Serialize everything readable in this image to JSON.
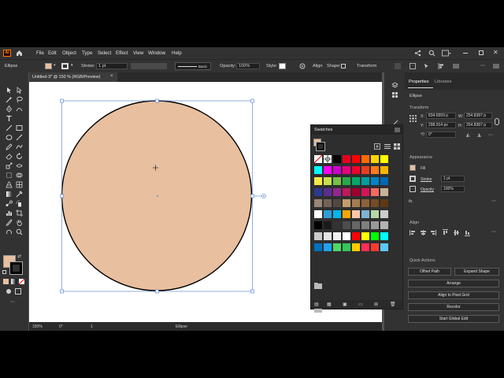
{
  "app": {
    "logo": "Ai"
  },
  "menu": [
    "File",
    "Edit",
    "Object",
    "Type",
    "Select",
    "Effect",
    "View",
    "Window",
    "Help"
  ],
  "control_bar": {
    "selection_type": "Ellipse",
    "stroke_label": "Stroke:",
    "stroke_value": "1 pt",
    "brush_label": "Basic",
    "opacity_label": "Opacity:",
    "opacity_value": "100%",
    "style_label": "Style:",
    "align_label": "Align",
    "shape_label": "Shape:",
    "transform_label": "Transform"
  },
  "document": {
    "tab_title": "Untitled-3* @ 150 % (RGB/Preview)",
    "close": "×"
  },
  "status": {
    "zoom": "150%",
    "rotation": "0°",
    "page": "1",
    "tool": "Ellipse"
  },
  "colors": {
    "fill": "#e8bf9f",
    "stroke": "#000000",
    "canvas": "#ffffff",
    "selection": "#4a7bd0"
  },
  "properties": {
    "tabs": [
      "Properties",
      "Libraries"
    ],
    "object_type": "Ellipse",
    "transform_title": "Transform",
    "x_label": "X:",
    "x_value": "834.6559 p",
    "y_label": "Y:",
    "y_value": "298.914 px",
    "w_label": "W:",
    "w_value": "254.8387 p",
    "h_label": "H:",
    "h_value": "254.8387 p",
    "angle_value": "0°",
    "appearance_title": "Appearance",
    "fill_label": "Fill",
    "stroke_label": "Stroke",
    "stroke_value": "1 pt",
    "opacity_label": "Opacity",
    "opacity_value": "100%",
    "fx_label": "fx.",
    "align_title": "Align",
    "quick_actions_title": "Quick Actions",
    "buttons": [
      "Offset Path",
      "Expand Shape",
      "Arrange",
      "Align to Pixel Grid",
      "Recolor",
      "Start Global Edit"
    ]
  },
  "swatches_panel": {
    "title": "Swatches",
    "rows": [
      [
        "#ff0000",
        "#ffffff",
        "#000000",
        "#e6001e",
        "#ff0000",
        "#ff6a00",
        "#ffd600",
        "#ffff00"
      ],
      [
        "#00ffff",
        "#ff00ff",
        "#cc00cc",
        "#e6007e",
        "#f0002e",
        "#e83e20",
        "#ff7b1c",
        "#f4b400"
      ],
      [
        "#f6e84a",
        "#c8e04a",
        "#76c043",
        "#2aa84a",
        "#00a86b",
        "#00a0a0",
        "#0085c8",
        "#0068b4"
      ],
      [
        "#2b3990",
        "#5c2d91",
        "#92278f",
        "#c2185b",
        "#a0002e",
        "#d4145a",
        "#f26b61",
        "#c7b299"
      ],
      [
        "#998675",
        "#736357",
        "#534741",
        "#c69c6d",
        "#a67c52",
        "#8c6239",
        "#754c24",
        "#603813"
      ],
      [
        "#ffffff",
        "#2f9dd8",
        "#00b7eb",
        "#f7a600",
        "#f9c7a8",
        "#7fb3d5",
        "#b5d7a8",
        "#cccccc"
      ],
      [
        "#000000",
        "#1a1a1a",
        "#333333",
        "#4d4d4d",
        "#666666",
        "#808080",
        "#999999",
        "#b3b3b3"
      ],
      [
        "#cccccc",
        "#e6e6e6",
        "#f2f2f2",
        "#ffffff",
        "#ff0000",
        "#ffff00",
        "#00ff00",
        "#00ffff"
      ],
      [
        "#0070c0",
        "#21a1f1",
        "#4cd964",
        "#34c759",
        "#ffcc00",
        "#ff2d55",
        "#ff3b30",
        "#5ac8fa"
      ]
    ]
  }
}
